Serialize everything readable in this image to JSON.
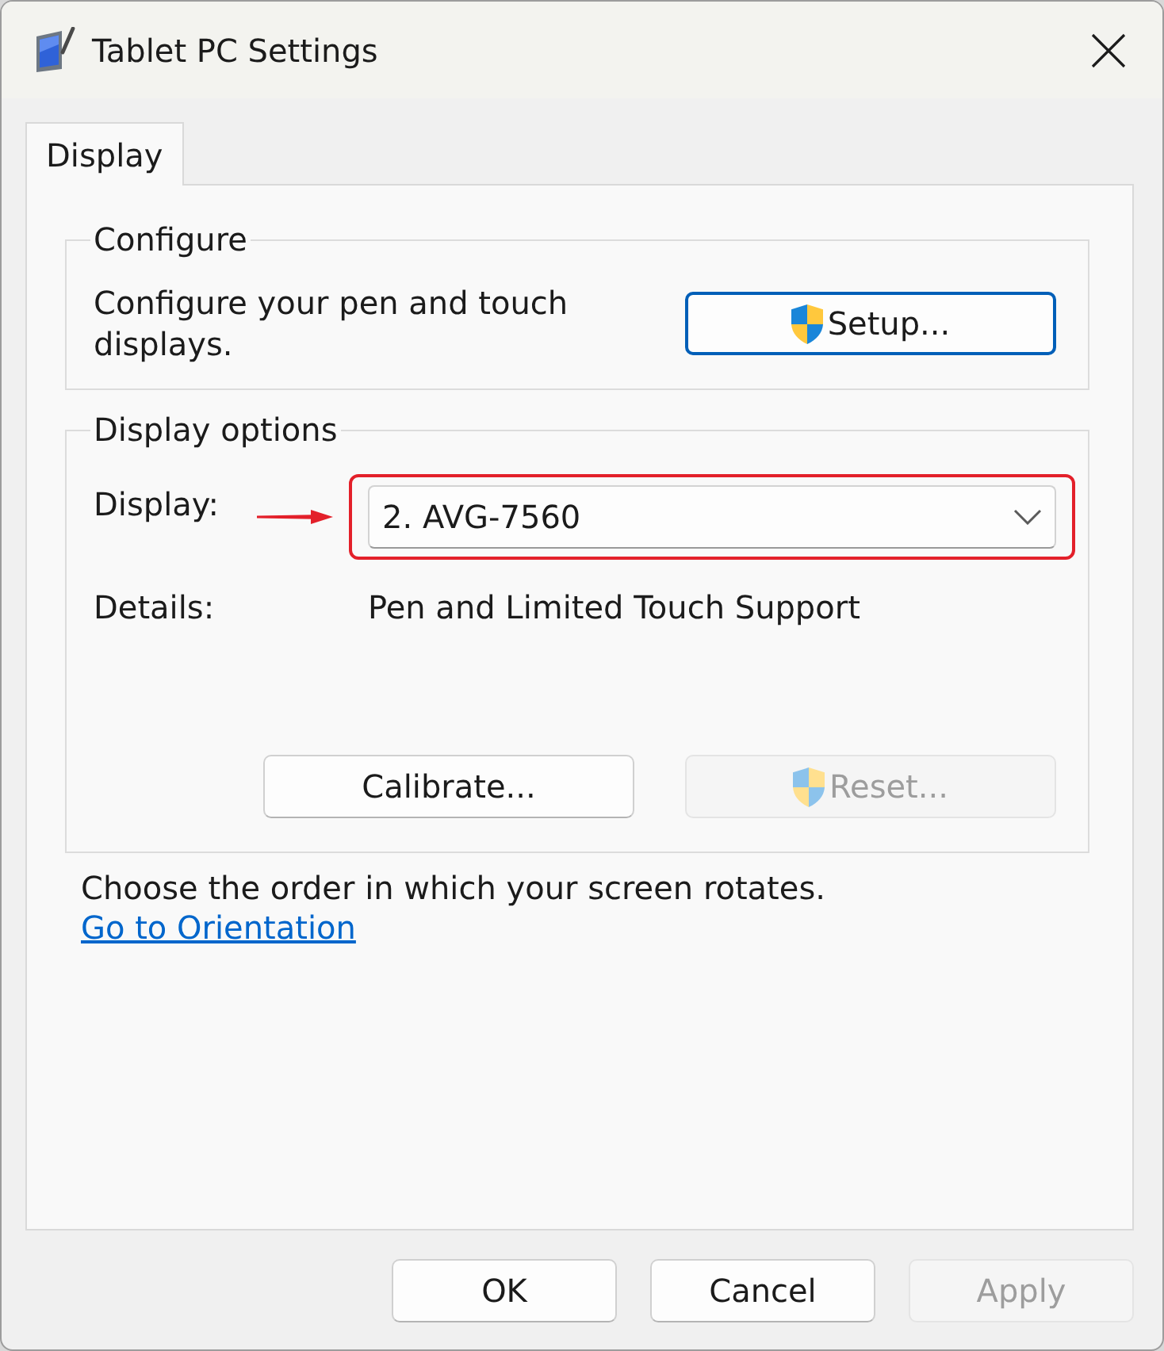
{
  "window": {
    "title": "Tablet PC Settings"
  },
  "tabs": [
    {
      "label": "Display",
      "selected": true
    }
  ],
  "configure": {
    "legend": "Configure",
    "description": "Configure your pen and touch displays.",
    "button": {
      "label": "Setup...",
      "kind": "shield",
      "focused": true,
      "disabled": false
    }
  },
  "display_options": {
    "legend": "Display options",
    "display_label": "Display:",
    "display_value": "2. AVG-7560",
    "highlighted": true,
    "pointer_arrow": true,
    "details_label": "Details:",
    "details_value": "Pen and Limited Touch Support",
    "buttons": [
      {
        "label": "Calibrate...",
        "kind": "plain",
        "disabled": false
      },
      {
        "label": "Reset...",
        "kind": "shield",
        "disabled": true
      }
    ]
  },
  "orientation": {
    "text": "Choose the order in which your screen rotates.",
    "link": "Go to Orientation"
  },
  "buttons": [
    {
      "label": "OK",
      "disabled": false
    },
    {
      "label": "Cancel",
      "disabled": false
    },
    {
      "label": "Apply",
      "disabled": true
    }
  ]
}
